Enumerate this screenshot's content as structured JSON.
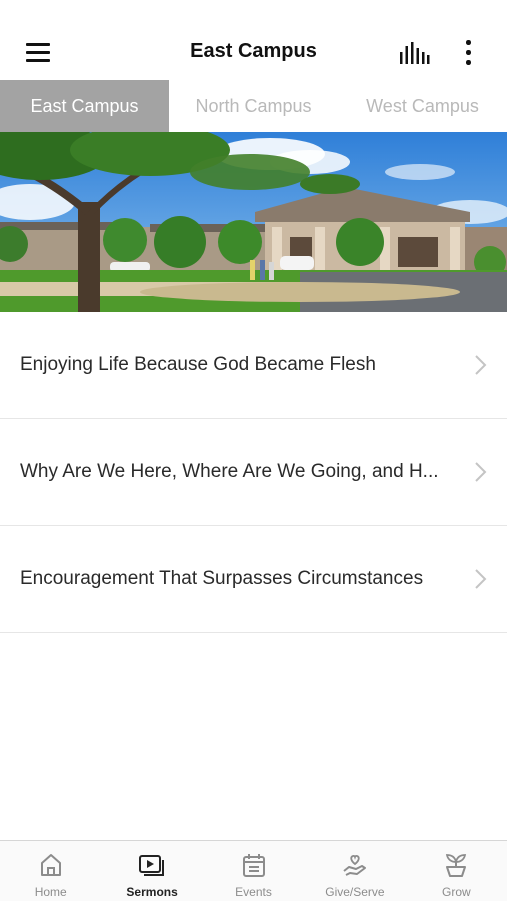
{
  "header": {
    "title": "East Campus",
    "menu_icon": "hamburger-menu-icon",
    "audio_icon": "audio-equalizer-icon",
    "more_icon": "more-vertical-icon"
  },
  "tabs": [
    {
      "label": "East Campus",
      "active": true
    },
    {
      "label": "North Campus",
      "active": false
    },
    {
      "label": "West Campus",
      "active": false
    }
  ],
  "sermons": [
    {
      "title": "Enjoying Life Because God Became Flesh"
    },
    {
      "title": "Why Are We Here, Where Are We Going, and H..."
    },
    {
      "title": "Encouragement That Surpasses Circumstances"
    }
  ],
  "tabbar": [
    {
      "label": "Home",
      "icon": "home-icon",
      "active": false
    },
    {
      "label": "Sermons",
      "icon": "sermons-video-icon",
      "active": true
    },
    {
      "label": "Events",
      "icon": "calendar-icon",
      "active": false
    },
    {
      "label": "Give/Serve",
      "icon": "give-hand-heart-icon",
      "active": false
    },
    {
      "label": "Grow",
      "icon": "plant-sprout-icon",
      "active": false
    }
  ],
  "colors": {
    "active_tab_bg": "#a3a3a3",
    "inactive_tab_text": "#b9b9b9",
    "tabbar_inactive": "#8c8c8c"
  }
}
